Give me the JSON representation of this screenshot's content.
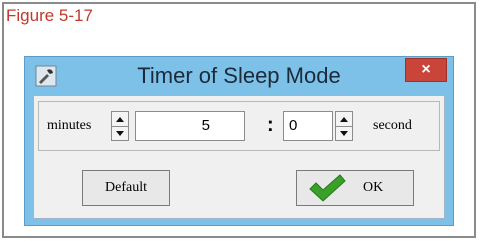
{
  "figure": {
    "label": "Figure 5-17"
  },
  "window": {
    "title": "Timer of Sleep Mode",
    "close_label": "×",
    "icon": "wrench-icon"
  },
  "timer": {
    "minutes_label": "minutes",
    "minutes_value": "5",
    "separator": ":",
    "seconds_value": "0",
    "seconds_label": "second"
  },
  "buttons": {
    "default_label": "Default",
    "ok_label": "OK",
    "ok_icon": "checkmark-icon"
  },
  "colors": {
    "title_bar": "#7ec1e8",
    "close_button": "#c9453a",
    "figure_label": "#c0392b",
    "check": "#3aa02a"
  }
}
